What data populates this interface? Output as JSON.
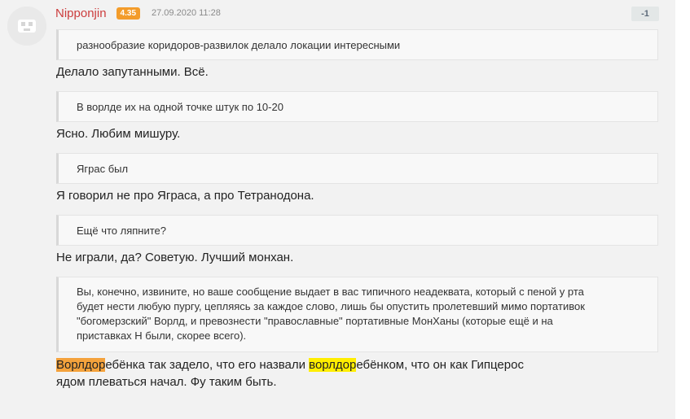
{
  "comment": {
    "author": "Nipponjin",
    "karma": "4.35",
    "date": "27.09.2020 11:28",
    "score": "-1",
    "avatar_icon": "default-avatar-icon",
    "blocks": {
      "q1": "разнообразие коридоров-развилок делало локации интересными",
      "r1": "Делало запутанными. Всё.",
      "q2": "В ворлде их на одной точке штук по 10-20",
      "r2": "Ясно. Любим мишуру.",
      "q3": "Ягрaс был",
      "r3": "Я говорил не про Яграса, а про Тетранодона.",
      "q4": "Ещё что ляпните?",
      "r4": "Не играли, да? Советую. Лучший монхан.",
      "q5_line1": "Вы, конечно, извините, но ваше сообщение выдает в вас типичного неадеквата, который с пеной у рта",
      "q5_line2": "будет нести любую пургу, цепляясь за каждое слово, лишь бы опустить пролетевший мимо портативок",
      "q5_line3": "\"богомерзский\" Ворлд, и превознести \"православные\" портативные МонХаны (которые ещё и на",
      "q5_line4": "приставках Н были, скорее всего).",
      "final_hl1": "Ворлдор",
      "final_t1": "ебёнка так задело, что его назвали ",
      "final_hl2": "ворлдор",
      "final_t2": "ебёнком, что он как Гипцерос",
      "final_line2": "ядом плеваться начал. Фу таким быть."
    }
  },
  "colors": {
    "author": "#cc3d3d",
    "karma_badge": "#f39c2b",
    "highlight_orange": "#f4a23c",
    "highlight_yellow": "#ffee00"
  }
}
